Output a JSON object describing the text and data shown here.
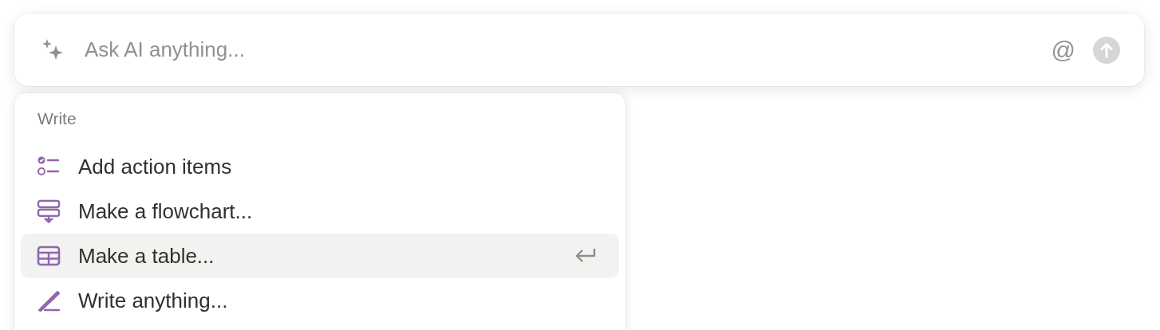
{
  "prompt": {
    "placeholder": "Ask AI anything...",
    "mention": "@"
  },
  "menu": {
    "section": "Write",
    "items": [
      {
        "label": "Add action items",
        "kind": "checklist",
        "selected": false
      },
      {
        "label": "Make a flowchart...",
        "kind": "flowchart",
        "selected": false
      },
      {
        "label": "Make a table...",
        "kind": "table",
        "selected": true
      },
      {
        "label": "Write anything...",
        "kind": "pen",
        "selected": false
      }
    ]
  }
}
